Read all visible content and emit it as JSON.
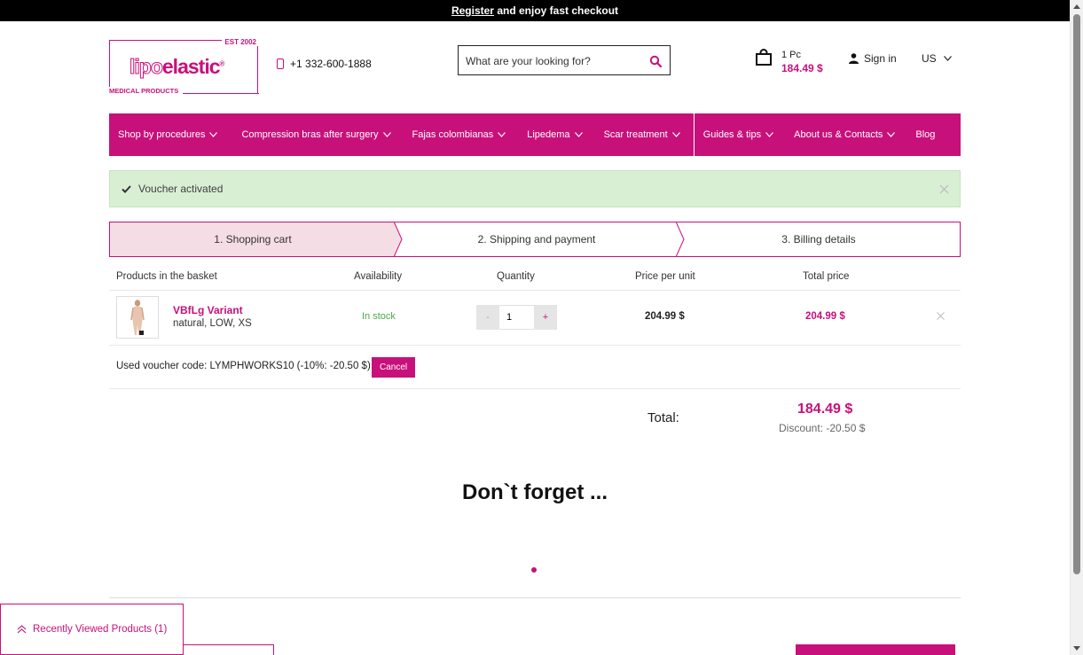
{
  "topbar": {
    "register_link": "Register",
    "text": " and enjoy fast checkout"
  },
  "logo": {
    "est": "EST 2002",
    "brand_part1": "lipo",
    "brand_part2": "elastic",
    "registered": "®",
    "subtitle": "MEDICAL PRODUCTS"
  },
  "header": {
    "phone": "+1 332-600-1888",
    "search_placeholder": "What are your looking for?",
    "cart_count": "1 Pc",
    "cart_total": "184.49 $",
    "sign_in": "Sign in",
    "locale": "US"
  },
  "nav": [
    {
      "label": "Shop by procedures",
      "dropdown": true
    },
    {
      "label": "Compression bras after surgery",
      "dropdown": true
    },
    {
      "label": "Fajas colombianas",
      "dropdown": true
    },
    {
      "label": "Lipedema",
      "dropdown": true
    },
    {
      "label": "Scar treatment",
      "dropdown": true
    },
    {
      "label": "Guides & tips",
      "dropdown": true
    },
    {
      "label": "About us & Contacts",
      "dropdown": true
    },
    {
      "label": "Blog",
      "dropdown": false
    }
  ],
  "alert": {
    "message": "Voucher activated"
  },
  "steps": [
    "1. Shopping cart",
    "2. Shipping and payment",
    "3. Billing details"
  ],
  "table": {
    "headers": [
      "Products in the basket",
      "Availability",
      "Quantity",
      "Price per unit",
      "Total price"
    ],
    "item": {
      "name": "VBfLg Variant",
      "options": "natural, LOW, XS",
      "availability": "In stock",
      "quantity": "1",
      "qty_minus": "-",
      "qty_plus": "+",
      "unit_price": "204.99 $",
      "total_price": "204.99 $"
    }
  },
  "voucher": {
    "text": "Used voucher code: LYMPHWORKS10 (-10%: -20.50 $)",
    "cancel_label": "Cancel"
  },
  "summary": {
    "total_label": "Total:",
    "total_value": "184.49 $",
    "discount": "Discount: -20.50 $"
  },
  "dont_forget": "Don`t forget ...",
  "recently_viewed": "Recently Viewed Products (1)",
  "colors": {
    "brand": "#c8107b",
    "success_bg": "#d9efd4",
    "stock_green": "#4ca94a"
  }
}
